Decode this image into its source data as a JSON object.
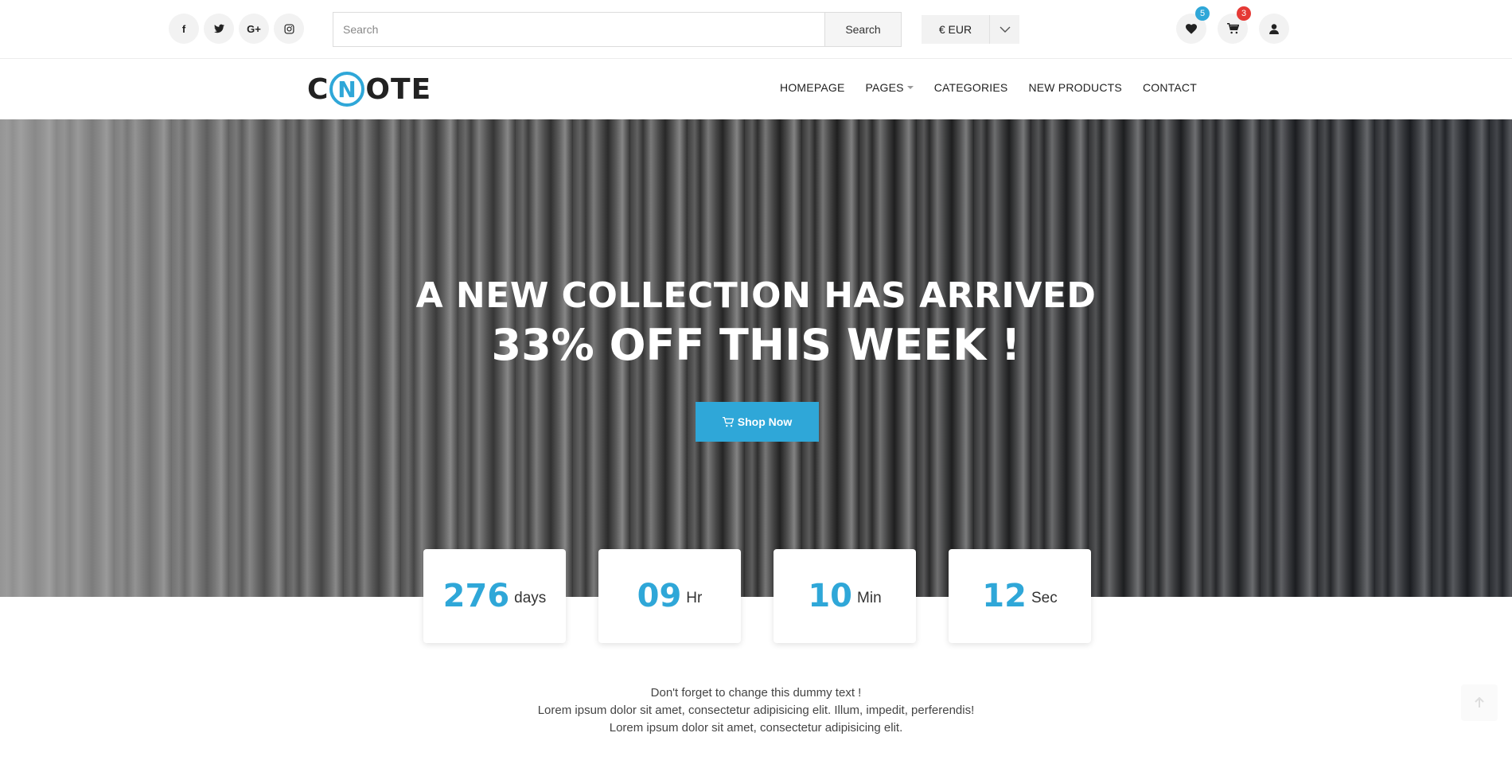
{
  "topbar": {
    "social": [
      {
        "name": "facebook",
        "glyph": "f"
      },
      {
        "name": "twitter",
        "glyph": "t"
      },
      {
        "name": "google-plus",
        "glyph": "G+"
      },
      {
        "name": "instagram",
        "glyph": "◎"
      }
    ],
    "search": {
      "placeholder": "Search",
      "button_label": "Search"
    },
    "currency": {
      "label": "€ EUR"
    },
    "wishlist_count": "5",
    "cart_count": "3"
  },
  "nav": {
    "logo": {
      "prefix": "C",
      "circle": "N",
      "suffix": "OTE"
    },
    "items": [
      {
        "label": "HOMEPAGE"
      },
      {
        "label": "PAGES"
      },
      {
        "label": "CATEGORIES"
      },
      {
        "label": "NEW PRODUCTS"
      },
      {
        "label": "CONTACT"
      }
    ]
  },
  "hero": {
    "line1": "A NEW COLLECTION HAS ARRIVED",
    "line2": "33% OFF THIS WEEK !",
    "button_label": "Shop Now"
  },
  "countdown": [
    {
      "value": "276",
      "unit": "days"
    },
    {
      "value": "09",
      "unit": "Hr"
    },
    {
      "value": "10",
      "unit": "Min"
    },
    {
      "value": "12",
      "unit": "Sec"
    }
  ],
  "info": {
    "line1": "Don't forget to change this dummy text !",
    "line2": "Lorem ipsum dolor sit amet, consectetur adipisicing elit. Illum, impedit, perferendis!",
    "line3": "Lorem ipsum dolor sit amet, consectetur adipisicing elit."
  },
  "colors": {
    "accent": "#2fa7d8",
    "badge_red": "#e53935"
  }
}
